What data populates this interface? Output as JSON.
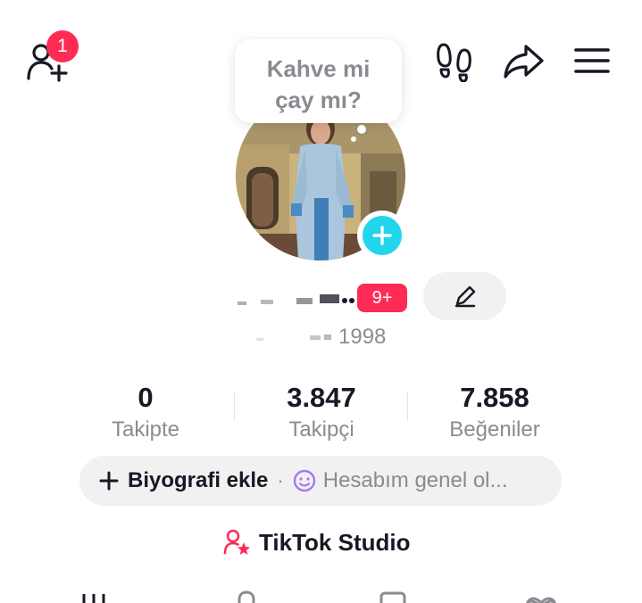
{
  "header": {
    "notification_count": "1"
  },
  "bubble": {
    "line1": "Kahve mi",
    "line2": "çay mı?"
  },
  "profile": {
    "age_badge": "9+",
    "year": "1998"
  },
  "stats": [
    {
      "value": "0",
      "label": "Takipte"
    },
    {
      "value": "3.847",
      "label": "Takipçi"
    },
    {
      "value": "7.858",
      "label": "Beğeniler"
    }
  ],
  "bio": {
    "add_label": "Biyografi ekle",
    "separator": "·",
    "hint": "Hesabım genel ol..."
  },
  "studio": {
    "label": "TikTok Studio"
  },
  "colors": {
    "accent": "#fe2c55",
    "cyan": "#20d5ec",
    "muted": "#8a8b91",
    "purple": "#a678f0"
  }
}
